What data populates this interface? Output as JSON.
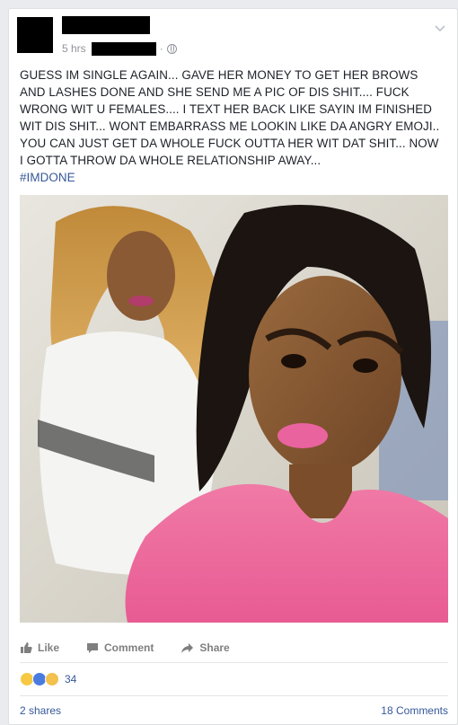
{
  "post": {
    "timestamp": "5 hrs",
    "separator": "·",
    "text": "GUESS IM SINGLE AGAIN... GAVE HER MONEY TO GET HER BROWS AND LASHES DONE AND SHE SEND ME A PIC OF DIS SHIT.... FUCK WRONG WIT U FEMALES.... I TEXT HER BACK LIKE SAYIN IM FINISHED WIT DIS SHIT... WONT EMBARRASS ME LOOKIN LIKE DA ANGRY EMOJI.. YOU CAN JUST GET DA WHOLE FUCK OUTTA HER WIT DAT SHIT... NOW I GOTTA THROW DA WHOLE RELATIONSHIP AWAY...",
    "hashtag": "#IMDONE",
    "privacy_icon": "globe-icon",
    "menu_icon": "chevron-down-icon"
  },
  "actions": {
    "like": "Like",
    "comment": "Comment",
    "share": "Share"
  },
  "reactions": {
    "icons": [
      "haha-icon",
      "like-icon",
      "sad-icon"
    ],
    "count": "34"
  },
  "footer": {
    "shares": "2 shares",
    "comments": "18 Comments"
  },
  "colors": {
    "link": "#365899",
    "meta": "#90949c",
    "action": "#7f7f7f"
  }
}
